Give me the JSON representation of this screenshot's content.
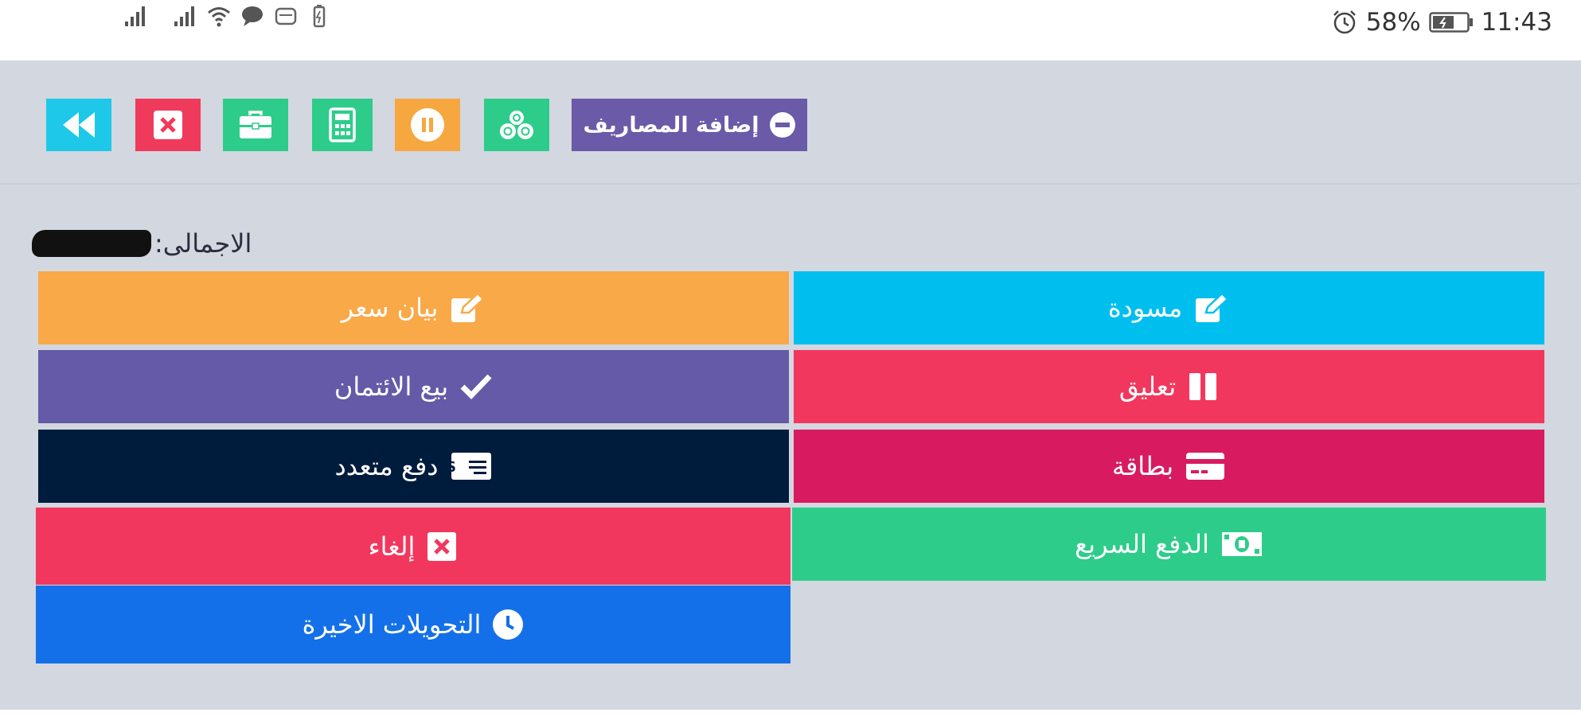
{
  "status_bar": {
    "battery_percent": "58%",
    "time": "11:43",
    "icons": [
      "signal-icon",
      "signal-icon",
      "wifi-icon",
      "chat-bubble-icon",
      "message-icon",
      "battery-small-icon",
      "alarm-icon",
      "battery-icon"
    ]
  },
  "toolbar": {
    "add_expenses_label": "إضافة المصاريف",
    "buttons": [
      {
        "icon": "rewind-icon",
        "color": "#1ec8e8"
      },
      {
        "icon": "close-icon",
        "color": "#f03a5c"
      },
      {
        "icon": "briefcase-icon",
        "color": "#2ecc8a"
      },
      {
        "icon": "calculator-icon",
        "color": "#2ecc8a"
      },
      {
        "icon": "pause-icon",
        "color": "#f7a740"
      },
      {
        "icon": "coins-icon",
        "color": "#2ecc8a"
      },
      {
        "icon": "minus-circle-icon",
        "color": "#6a5aa8"
      }
    ]
  },
  "total": {
    "label": "الاجمالى:"
  },
  "payment_buttons": {
    "draft": {
      "label": "مسودة",
      "color": "#00bfef",
      "icon": "edit-icon"
    },
    "quotation": {
      "label": "بيان سعر",
      "color": "#f9a948",
      "icon": "edit-icon"
    },
    "suspend": {
      "label": "تعليق",
      "color": "#f2375f",
      "icon": "pause-icon"
    },
    "credit_sale": {
      "label": "بيع الائتمان",
      "color": "#645aa8",
      "icon": "check-icon"
    },
    "card": {
      "label": "بطاقة",
      "color": "#d81b60",
      "icon": "credit-card-icon"
    },
    "multi_payment": {
      "label": "دفع متعدد",
      "color": "#001c3d",
      "icon": "money-check-icon"
    },
    "express_payment": {
      "label": "الدفع السريع",
      "color": "#2ecc8a",
      "icon": "cash-icon"
    },
    "cancel": {
      "label": "إلغاء",
      "color": "#f2375f",
      "icon": "close-box-icon"
    },
    "recent_transactions": {
      "label": "التحويلات الاخيرة",
      "color": "#1470e8",
      "icon": "clock-icon"
    }
  }
}
